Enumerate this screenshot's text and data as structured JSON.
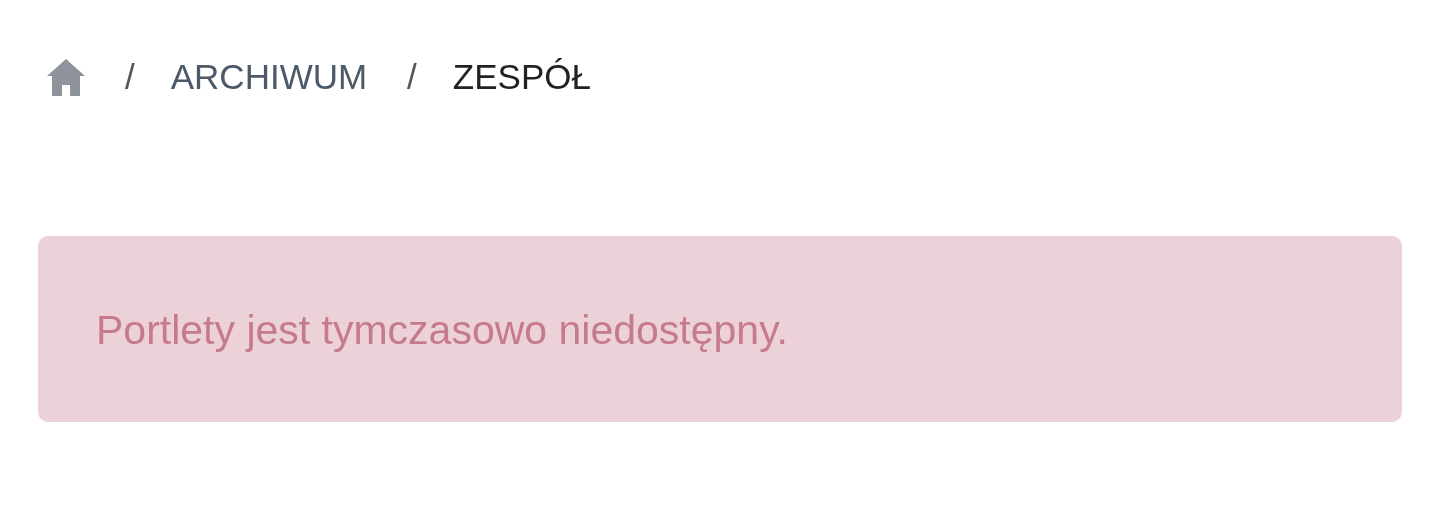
{
  "breadcrumb": [
    {
      "kind": "home"
    },
    {
      "kind": "link",
      "separator": "/",
      "label": "ARCHIWUM"
    },
    {
      "kind": "current",
      "separator": "/",
      "label": "ZESPÓŁ"
    }
  ],
  "alert": {
    "kind": "error",
    "message": "Portlety jest tymczasowo niedostępny."
  }
}
